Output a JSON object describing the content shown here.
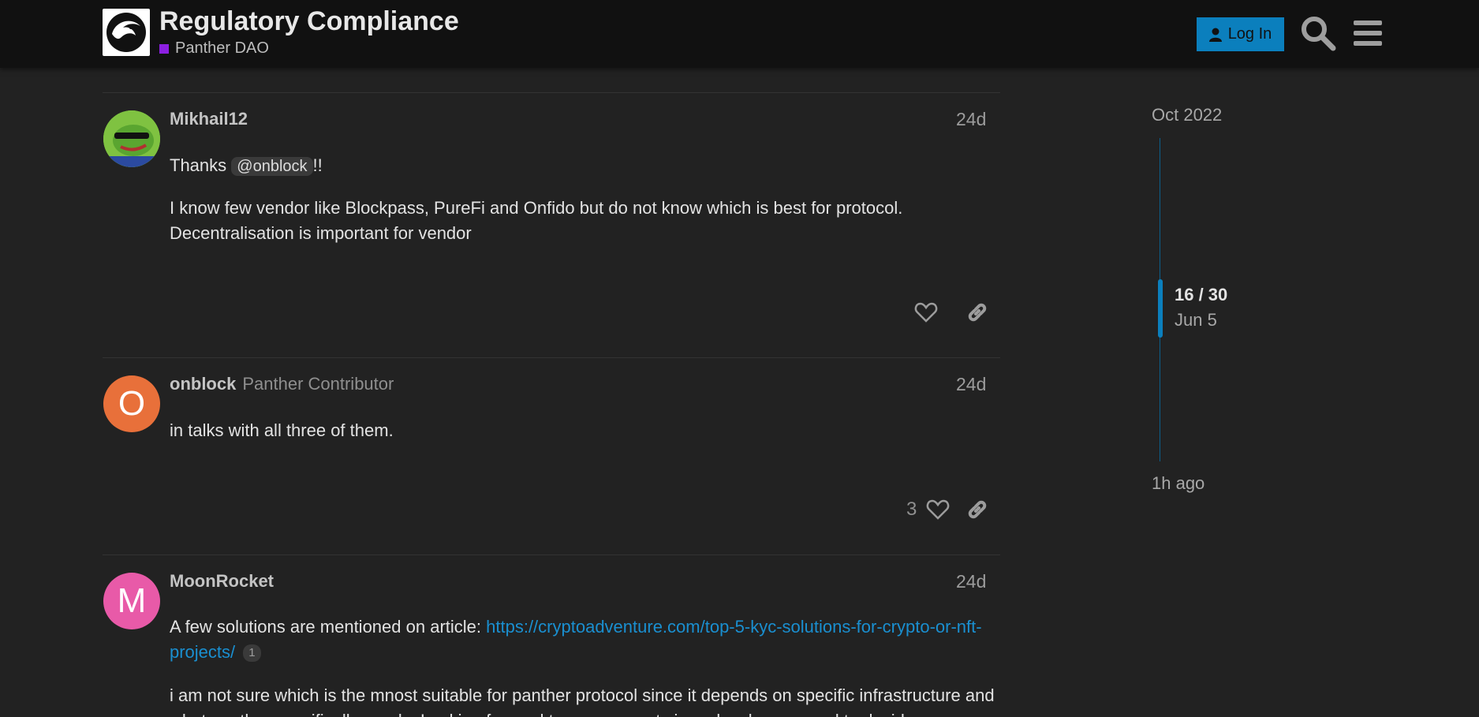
{
  "header": {
    "title": "Regulatory Compliance",
    "category": "Panther DAO",
    "category_color": "#8c1fe0",
    "login_label": "Log In",
    "accent": "#0b7fbd"
  },
  "posts": [
    {
      "username": "Mikhail12",
      "date": "24d",
      "p1_before": "Thanks",
      "mention": "@onblock",
      "p1_after": "!!",
      "p2": "I know few vendor like Blockpass, PureFi and Onfido but do not know which is best for protocol. Decentralisation is important for vendor"
    },
    {
      "username": "onblock",
      "user_title": "Panther Contributor",
      "avatar_letter": "O",
      "avatar_color": "#e8703a",
      "date": "24d",
      "text": "in talks with all three of them.",
      "likes": "3"
    },
    {
      "username": "MoonRocket",
      "avatar_letter": "M",
      "avatar_color": "#e85aa8",
      "date": "24d",
      "p1_before": "A few solutions are mentioned on article:",
      "link": "https://cryptoadventure.com/top-5-kyc-solutions-for-crypto-or-nft-projects/",
      "link_clicks": "1",
      "p2": "i am not sure which is the mnost suitable for panther protocol since it depends on specific infrastructure and what panther specifically needs. Looking forward to assessment since developers need to decide"
    }
  ],
  "timeline": {
    "start": "Oct 2022",
    "position": "16 / 30",
    "current_date": "Jun 5",
    "end": "1h ago"
  }
}
